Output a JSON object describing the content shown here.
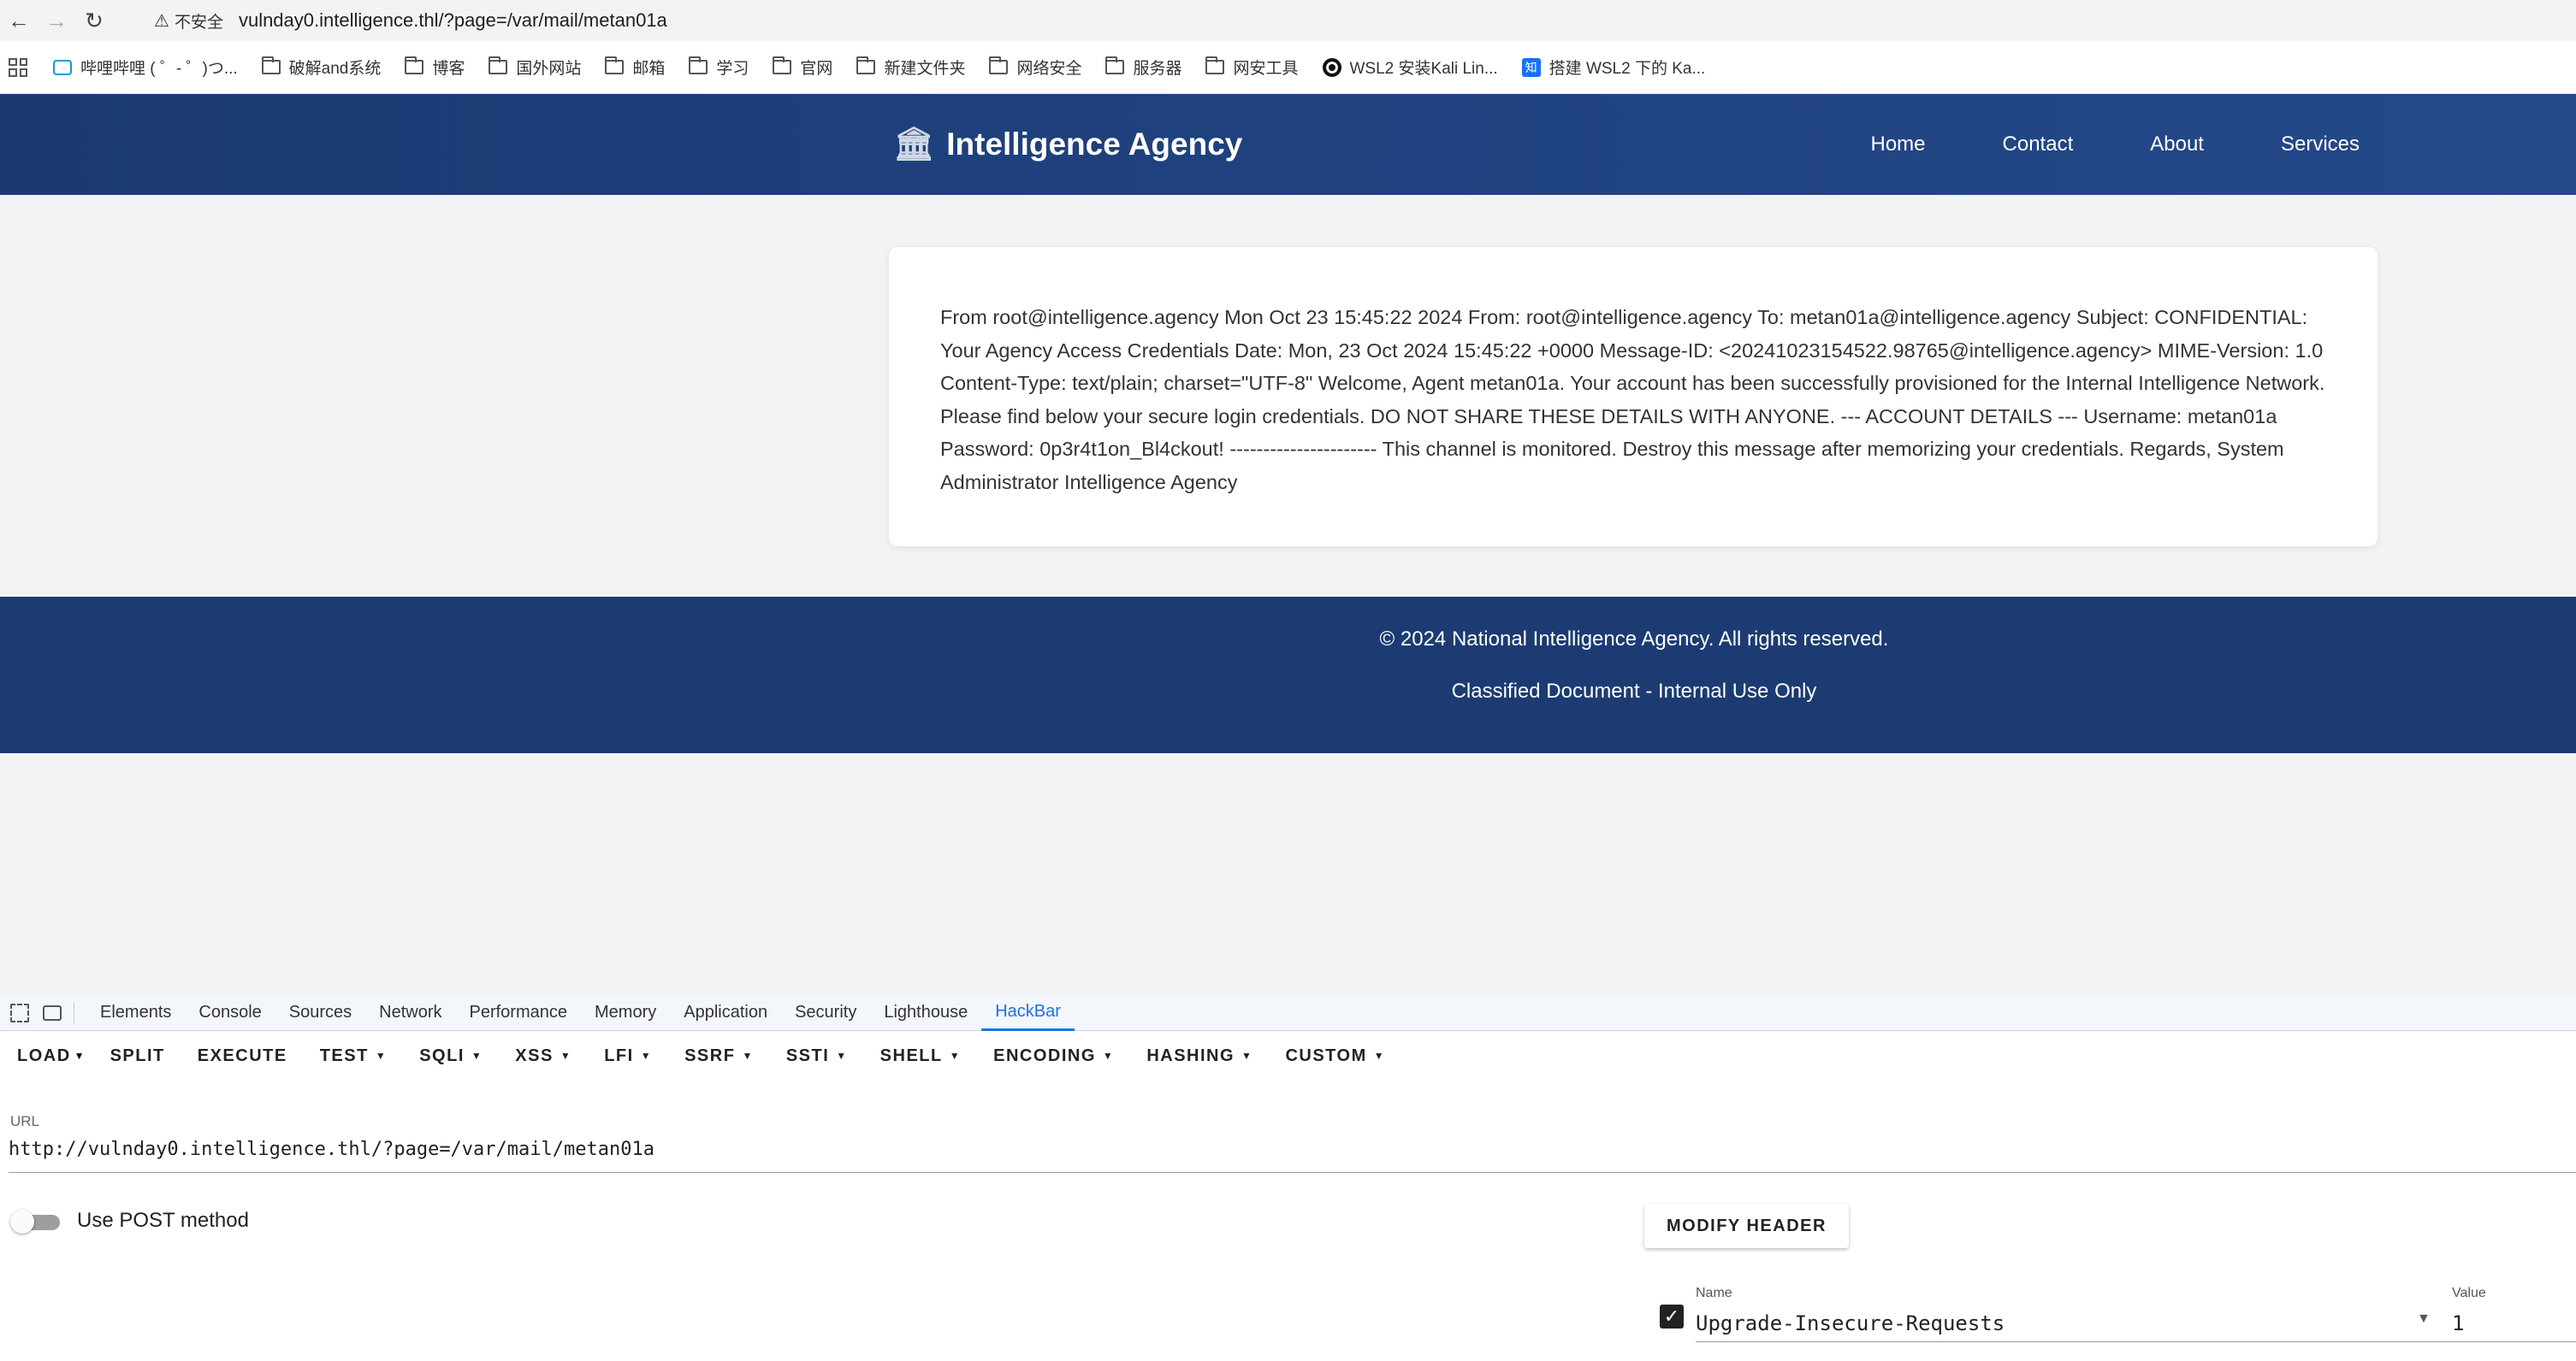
{
  "browser": {
    "security_label": "不安全",
    "url": "vulnday0.intelligence.thl/?page=/var/mail/metan01a",
    "bookmarks": [
      "哔哩哔哩 ( ゜- ゜)つ...",
      "破解and系统",
      "博客",
      "国外网站",
      "邮箱",
      "学习",
      "官网",
      "新建文件夹",
      "网络安全",
      "服务器",
      "网安工具",
      "WSL2 安装Kali Lin...",
      "搭建 WSL2 下的 Ka..."
    ]
  },
  "site": {
    "brand": "Intelligence Agency",
    "nav": [
      "Home",
      "Contact",
      "About",
      "Services"
    ],
    "mail_content": "From root@intelligence.agency Mon Oct 23 15:45:22 2024 From: root@intelligence.agency To: metan01a@intelligence.agency Subject: CONFIDENTIAL: Your Agency Access Credentials Date: Mon, 23 Oct 2024 15:45:22 +0000 Message-ID: <20241023154522.98765@intelligence.agency> MIME-Version: 1.0 Content-Type: text/plain; charset=\"UTF-8\" Welcome, Agent metan01a. Your account has been successfully provisioned for the Internal Intelligence Network. Please find below your secure login credentials. DO NOT SHARE THESE DETAILS WITH ANYONE. --- ACCOUNT DETAILS --- Username: metan01a Password: 0p3r4t1on_Bl4ckout! ---------------------- This channel is monitored. Destroy this message after memorizing your credentials. Regards, System Administrator Intelligence Agency",
    "footer_line1": "© 2024 National Intelligence Agency. All rights reserved.",
    "footer_line2": "Classified Document - Internal Use Only"
  },
  "devtools": {
    "tabs": [
      "Elements",
      "Console",
      "Sources",
      "Network",
      "Performance",
      "Memory",
      "Application",
      "Security",
      "Lighthouse",
      "HackBar"
    ],
    "active_tab": "HackBar",
    "hackbar": {
      "buttons": [
        "LOAD",
        "SPLIT",
        "EXECUTE",
        "TEST",
        "SQLI",
        "XSS",
        "LFI",
        "SSRF",
        "SSTI",
        "SHELL",
        "ENCODING",
        "HASHING",
        "CUSTOM"
      ],
      "url_label": "URL",
      "url_value": "http://vulnday0.intelligence.thl/?page=/var/mail/metan01a",
      "post_label": "Use POST method",
      "post_enabled": false,
      "modify_header_label": "MODIFY HEADER",
      "header_name_label": "Name",
      "header_value_label": "Value",
      "header_name": "Upgrade-Insecure-Requests",
      "header_value": "1",
      "header_checked": true
    }
  },
  "colors": {
    "header_bg": "#1e3f78",
    "footer_bg": "#1c3b73",
    "accent": "#1a73e8"
  }
}
